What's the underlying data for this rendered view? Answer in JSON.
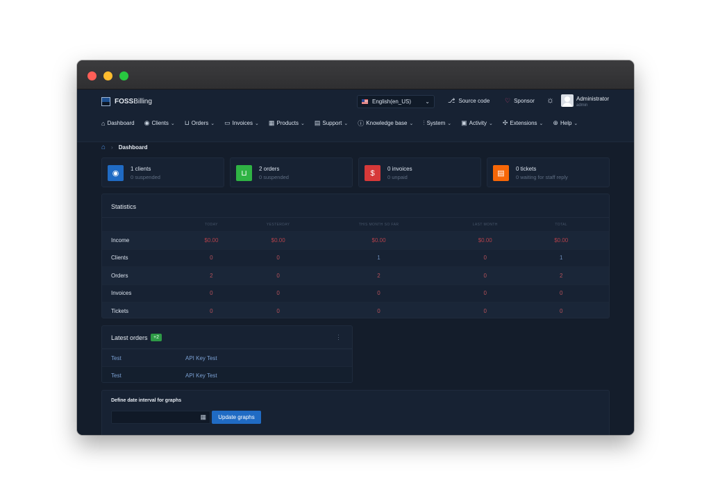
{
  "header": {
    "logo_bold": "FOSS",
    "logo_rest": "Billing",
    "language": "English(en_US)",
    "source_code": "Source code",
    "sponsor": "Sponsor",
    "user_name": "Administrator",
    "user_role": "admin"
  },
  "nav": {
    "items": [
      {
        "label": "Dashboard",
        "icon": "home-icon"
      },
      {
        "label": "Clients",
        "icon": "user-circle-icon"
      },
      {
        "label": "Orders",
        "icon": "cart-icon"
      },
      {
        "label": "Invoices",
        "icon": "cash-icon"
      },
      {
        "label": "Products",
        "icon": "grid-icon"
      },
      {
        "label": "Support",
        "icon": "message-icon"
      },
      {
        "label": "Knowledge base",
        "icon": "info-icon"
      },
      {
        "label": "System",
        "icon": "sliders-icon"
      },
      {
        "label": "Activity",
        "icon": "clipboard-icon"
      },
      {
        "label": "Extensions",
        "icon": "puzzle-icon"
      },
      {
        "label": "Help",
        "icon": "globe-icon"
      }
    ]
  },
  "breadcrumb": {
    "current": "Dashboard"
  },
  "cards": [
    {
      "title": "1 clients",
      "subtitle": "0 suspended",
      "color": "#206bc4",
      "icon": "user-circle-icon"
    },
    {
      "title": "2 orders",
      "subtitle": "0 suspended",
      "color": "#2fb344",
      "icon": "cart-icon"
    },
    {
      "title": "0 invoices",
      "subtitle": "0 unpaid",
      "color": "#d63939",
      "icon": "dollar-icon"
    },
    {
      "title": "0 tickets",
      "subtitle": "0 waiting for staff reply",
      "color": "#f76707",
      "icon": "message-icon"
    }
  ],
  "statistics": {
    "title": "Statistics",
    "columns": [
      "",
      "Today",
      "Yesterday",
      "This month so far",
      "Last month",
      "Total"
    ],
    "rows": [
      {
        "label": "Income",
        "values": [
          "$0.00",
          "$0.00",
          "$0.00",
          "$0.00",
          "$0.00"
        ]
      },
      {
        "label": "Clients",
        "values": [
          "0",
          "0",
          "1",
          "0",
          "1"
        ]
      },
      {
        "label": "Orders",
        "values": [
          "2",
          "0",
          "2",
          "0",
          "2"
        ]
      },
      {
        "label": "Invoices",
        "values": [
          "0",
          "0",
          "0",
          "0",
          "0"
        ]
      },
      {
        "label": "Tickets",
        "values": [
          "0",
          "0",
          "0",
          "0",
          "0"
        ]
      }
    ]
  },
  "latest_orders": {
    "title": "Latest orders",
    "count": "+2",
    "rows": [
      {
        "client": "Test",
        "product": "API Key Test"
      },
      {
        "client": "Test",
        "product": "API Key Test"
      }
    ]
  },
  "graphs": {
    "label": "Define date interval for graphs",
    "date_value": "",
    "button": "Update graphs"
  }
}
